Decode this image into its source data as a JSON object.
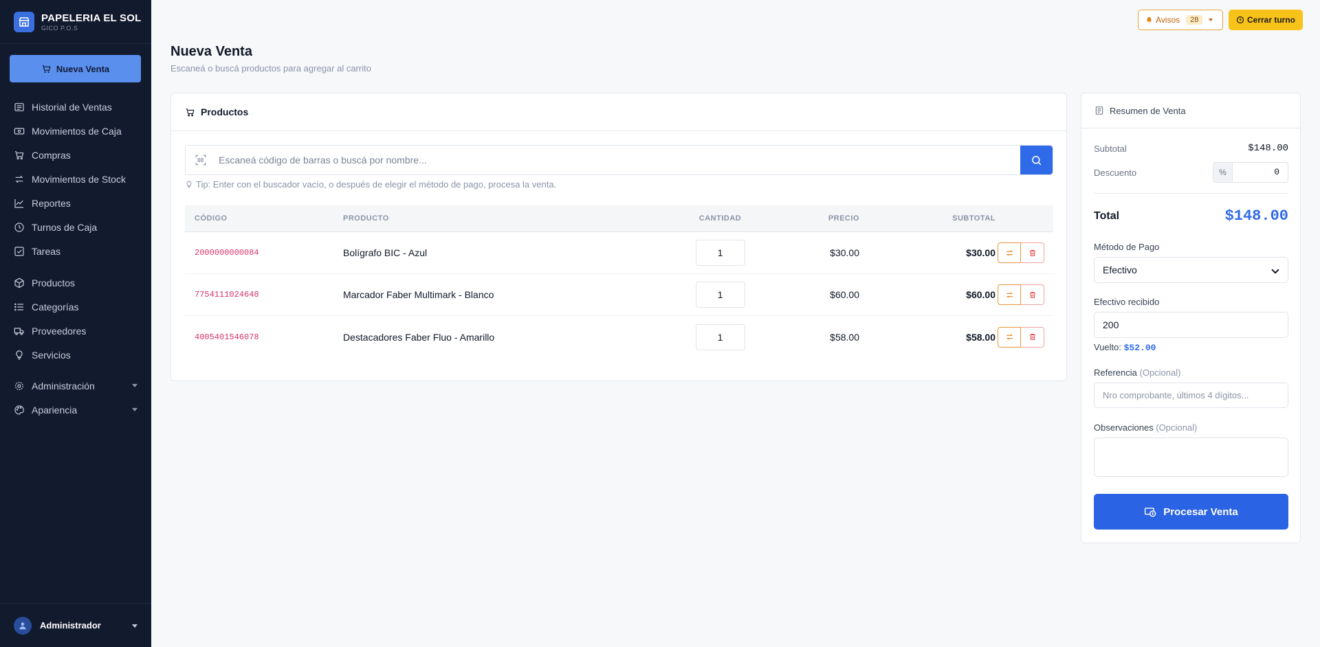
{
  "brand": {
    "name": "PAPELERIA EL SOL",
    "subtitle": "GICO P.O.S"
  },
  "sidebar": {
    "new_sale_label": "Nueva Venta",
    "items": [
      {
        "label": "Historial de Ventas",
        "icon": "list-icon"
      },
      {
        "label": "Movimientos de Caja",
        "icon": "cash-icon"
      },
      {
        "label": "Compras",
        "icon": "cart-icon"
      },
      {
        "label": "Movimientos de Stock",
        "icon": "arrows-icon"
      },
      {
        "label": "Reportes",
        "icon": "chart-icon"
      },
      {
        "label": "Turnos de Caja",
        "icon": "clock-icon"
      },
      {
        "label": "Tareas",
        "icon": "checkbox-icon"
      },
      {
        "label": "Productos",
        "icon": "box-icon"
      },
      {
        "label": "Categorías",
        "icon": "list-bullets-icon"
      },
      {
        "label": "Proveedores",
        "icon": "truck-icon"
      },
      {
        "label": "Servicios",
        "icon": "lightbulb-icon"
      },
      {
        "label": "Administración",
        "icon": "gear-icon"
      },
      {
        "label": "Apariencia",
        "icon": "palette-icon"
      }
    ],
    "user": "Administrador"
  },
  "topbar": {
    "avisos_label": "Avisos",
    "avisos_count": "28",
    "cerrar_label": "Cerrar turno"
  },
  "page": {
    "title": "Nueva Venta",
    "subtitle": "Escaneá o buscá productos para agregar al carrito"
  },
  "products": {
    "title": "Productos",
    "search_placeholder": "Escaneá código de barras o buscá por nombre...",
    "tip": "Tip: Enter con el buscador vacío, o después de elegir el método de pago, procesa la venta.",
    "columns": {
      "code": "CÓDIGO",
      "product": "PRODUCTO",
      "qty": "CANTIDAD",
      "price": "PRECIO",
      "subtotal": "SUBTOTAL"
    },
    "rows": [
      {
        "code": "2000000000084",
        "name": "Bolígrafo BIC - Azul",
        "qty": "1",
        "price": "$30.00",
        "subtotal": "$30.00"
      },
      {
        "code": "7754111024648",
        "name": "Marcador Faber Multimark - Blanco",
        "qty": "1",
        "price": "$60.00",
        "subtotal": "$60.00"
      },
      {
        "code": "4005401546078",
        "name": "Destacadores Faber Fluo - Amarillo",
        "qty": "1",
        "price": "$58.00",
        "subtotal": "$58.00"
      }
    ]
  },
  "summary": {
    "title": "Resumen de Venta",
    "subtotal_label": "Subtotal",
    "subtotal": "$148.00",
    "discount_label": "Descuento",
    "discount_symbol": "%",
    "discount": "0",
    "total_label": "Total",
    "total": "$148.00",
    "payment_label": "Método de Pago",
    "payment": "Efectivo",
    "cash_label": "Efectivo recibido",
    "cash": "200",
    "change_label": "Vuelto:",
    "change": "$52.00",
    "ref_label": "Referencia",
    "ref_optional": "(Opcional)",
    "ref_placeholder": "Nro comprobante, últimos 4 dígitos...",
    "obs_label": "Observaciones",
    "obs_optional": "(Opcional)",
    "process_label": "Procesar Venta"
  },
  "colors": {
    "sidebar_bg": "#121a2e",
    "accent": "#2f6ae8",
    "warning": "#f7c21a",
    "code": "#d6336c"
  }
}
